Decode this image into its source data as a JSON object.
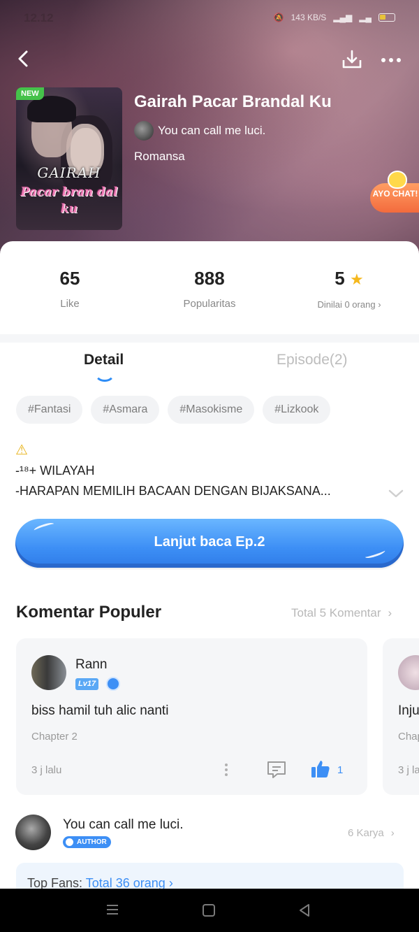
{
  "status_bar": {
    "time": "12.12",
    "net_speed": "143 KB/S",
    "battery_level": "4"
  },
  "header": {
    "back_icon": "chevron-left-icon",
    "download_icon": "download-icon",
    "more_icon": "more-dots-icon"
  },
  "book": {
    "badge": "NEW",
    "title": "Gairah Pacar Brandal Ku",
    "author": "You can call me luci.",
    "genre": "Romansa",
    "cover_title_line1": "GAIRAH",
    "cover_title_line2": "Pacar bran dal ku"
  },
  "chat_promo": {
    "label": "AYO CHAT!"
  },
  "stats": {
    "likes": "65",
    "likes_label": "Like",
    "popularity": "888",
    "popularity_label": "Popularitas",
    "rating": "5",
    "rating_label": "Dinilai 0 orang"
  },
  "tabs": [
    {
      "label": "Detail",
      "active": true
    },
    {
      "label": "Episode(2)",
      "active": false
    }
  ],
  "tags": [
    "#Fantasi",
    "#Asmara",
    "#Masokisme",
    "#Lizkook"
  ],
  "description": {
    "warning_icon": "warning-icon",
    "line1": "-¹⁸+ WILAYAH",
    "line2": "-HARAPAN MEMILIH BACAAN DENGAN BIJAKSANA..."
  },
  "read_button": {
    "label": "Lanjut baca Ep.2"
  },
  "comments_section": {
    "title": "Komentar Populer",
    "total_link": "Total 5 Komentar",
    "comments": [
      {
        "user": "Rann",
        "level": "Lv17",
        "text": "biss hamil tuh alic nanti",
        "chapter": "Chapter 2",
        "time": "3 j lalu",
        "likes": "1"
      },
      {
        "user": "",
        "text": "Inju",
        "chapter": "Chap",
        "time": "3 j la"
      }
    ]
  },
  "author_block": {
    "name": "You can call me luci.",
    "badge": "AUTHOR",
    "works": "6 Karya"
  },
  "fans": {
    "label": "Top Fans:",
    "link": "Total 36 orang"
  },
  "colors": {
    "accent": "#3d8ff5",
    "badge_new": "#45c24a",
    "star": "#f5b81d"
  }
}
